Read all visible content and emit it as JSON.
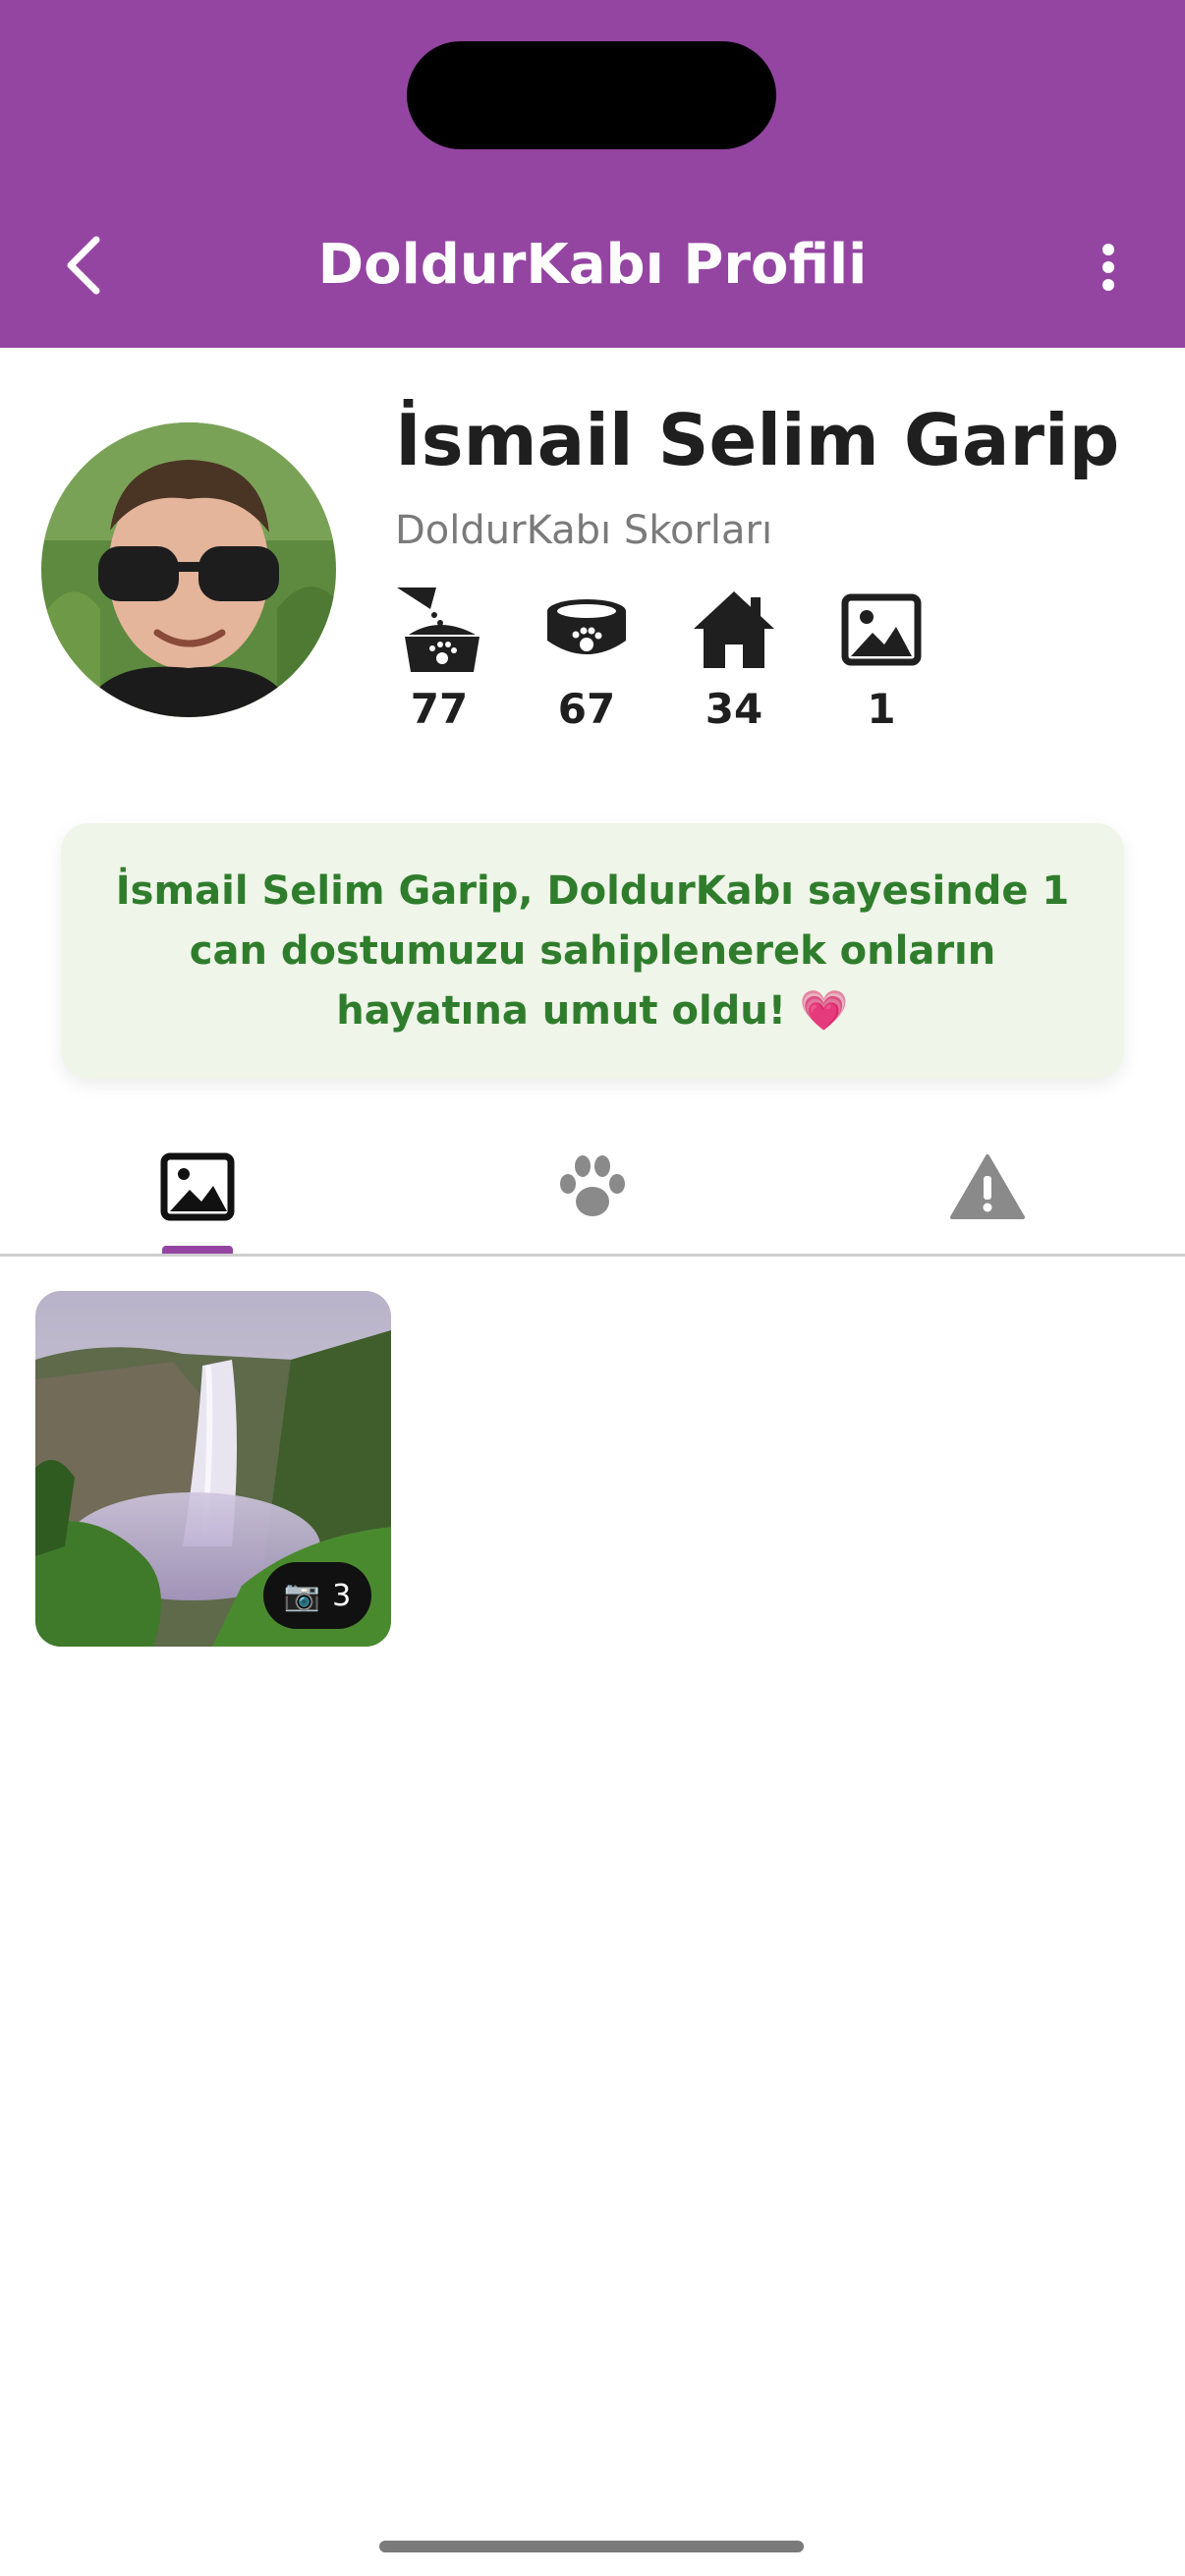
{
  "header": {
    "title": "DoldurKabı Profili",
    "back_icon": "chevron-left-icon",
    "menu_icon": "more-vertical-icon",
    "color": "#9445a2"
  },
  "profile": {
    "name": "İsmail Selim Garip",
    "subtitle": "DoldurKabı Skorları",
    "stats": [
      {
        "icon": "food-pour-bowl-icon",
        "value": "77"
      },
      {
        "icon": "pet-bowl-icon",
        "value": "67"
      },
      {
        "icon": "home-icon",
        "value": "34"
      },
      {
        "icon": "image-icon",
        "value": "1"
      }
    ]
  },
  "banner": {
    "text": "İsmail Selim Garip, DoldurKabı sayesinde 1 can dostumuzu sahiplenerek onların hayatına umut oldu! 💗",
    "text_color": "#2f7d2c",
    "background": "#eff5e9"
  },
  "tabs": [
    {
      "icon": "image-icon",
      "selected": true
    },
    {
      "icon": "paw-icon",
      "selected": false
    },
    {
      "icon": "warning-icon",
      "selected": false
    }
  ],
  "gallery": {
    "items": [
      {
        "photo_count": "3",
        "badge_icon": "camera-icon"
      }
    ]
  }
}
